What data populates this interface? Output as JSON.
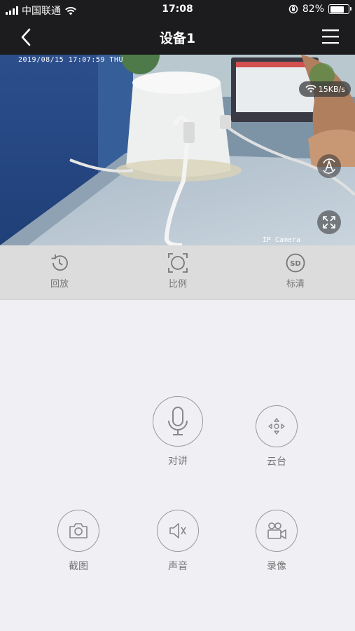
{
  "status_bar": {
    "carrier": "中国联通",
    "time": "17:08",
    "battery_percent": "82%",
    "battery_level": 0.82
  },
  "navbar": {
    "title": "设备1",
    "back_icon": "chevron-left-icon",
    "menu_icon": "hamburger-menu-icon"
  },
  "video": {
    "osd_timestamp": "2019/08/15 17:07:59 THU",
    "osd_camera_label": "IP Camera",
    "network_speed": "15KB/s"
  },
  "toolbar": {
    "items": [
      {
        "label": "回放",
        "icon": "history-icon"
      },
      {
        "label": "比例",
        "icon": "aspect-ratio-icon"
      },
      {
        "label": "标清",
        "icon": "sd-quality-icon"
      }
    ]
  },
  "controls": {
    "talk": {
      "label": "对讲",
      "icon": "microphone-icon"
    },
    "ptz": {
      "label": "云台",
      "icon": "direction-pad-icon"
    },
    "snapshot": {
      "label": "截图",
      "icon": "camera-icon"
    },
    "sound": {
      "label": "声音",
      "icon": "speaker-muted-icon"
    },
    "record": {
      "label": "录像",
      "icon": "video-camera-icon"
    }
  },
  "colors": {
    "header_bg": "#1c1c1e",
    "page_bg": "#efeff4",
    "toolbar_bg": "#dcdcdc",
    "icon_gray": "#777777"
  }
}
